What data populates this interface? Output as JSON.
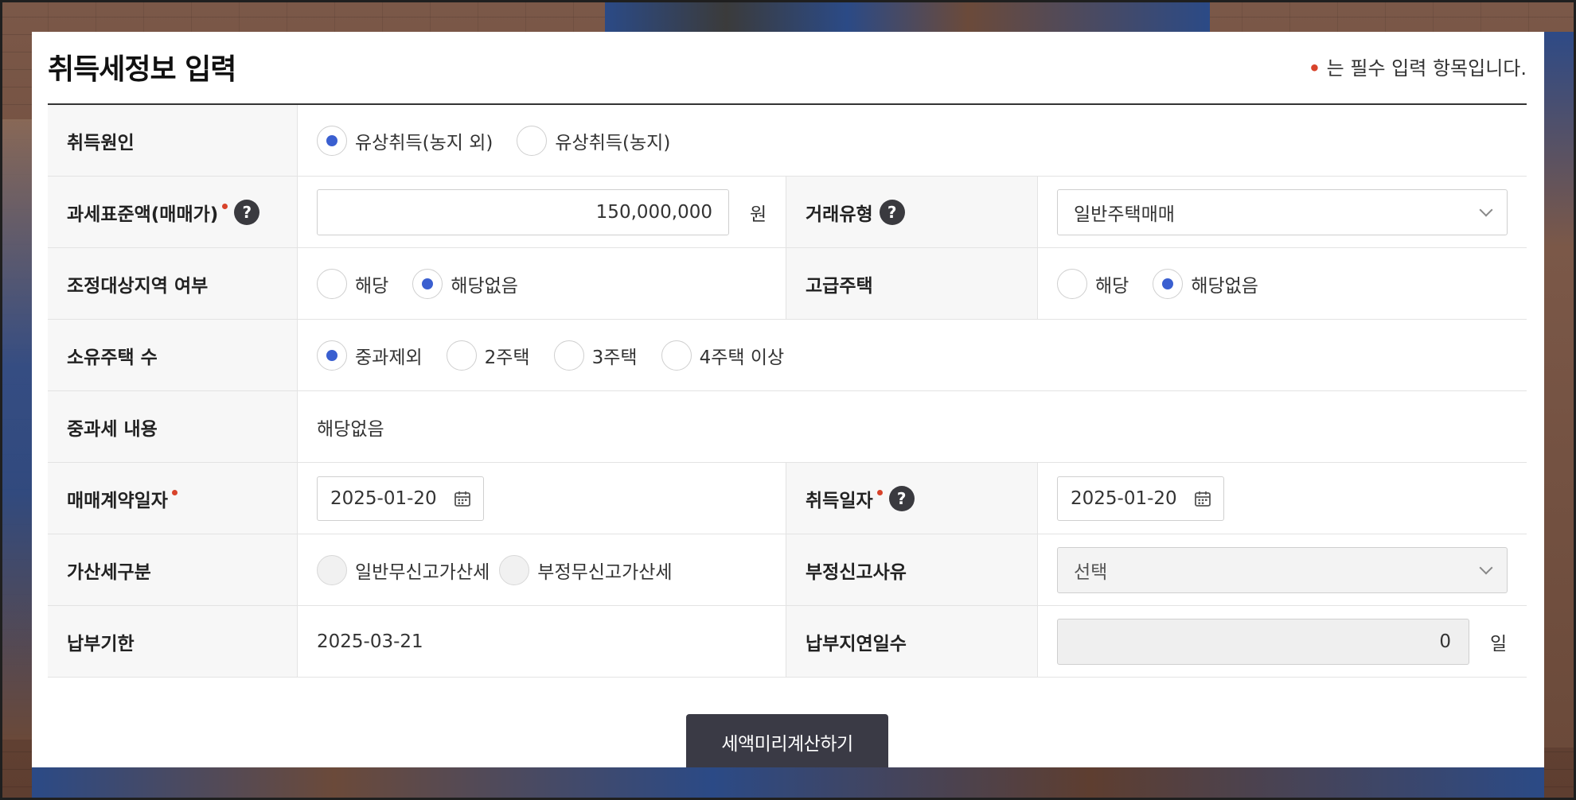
{
  "title": "취득세정보 입력",
  "required_note": "는 필수 입력 항목입니다.",
  "rows": {
    "acq_cause": {
      "label": "취득원인",
      "options": [
        "유상취득(농지 외)",
        "유상취득(농지)"
      ],
      "selected": 0
    },
    "tax_base": {
      "label": "과세표준액(매매가)",
      "value": "150,000,000",
      "unit": "원"
    },
    "trade_type": {
      "label": "거래유형",
      "value": "일반주택매매"
    },
    "adjust_area": {
      "label": "조정대상지역 여부",
      "options": [
        "해당",
        "해당없음"
      ],
      "selected": 1
    },
    "luxury": {
      "label": "고급주택",
      "options": [
        "해당",
        "해당없음"
      ],
      "selected": 1
    },
    "house_count": {
      "label": "소유주택 수",
      "options": [
        "중과제외",
        "2주택",
        "3주택",
        "4주택 이상"
      ],
      "selected": 0
    },
    "heavy_tax": {
      "label": "중과세 내용",
      "value": "해당없음"
    },
    "contract_date": {
      "label": "매매계약일자",
      "value": "2025-01-20"
    },
    "acq_date": {
      "label": "취득일자",
      "value": "2025-01-20"
    },
    "penalty_type": {
      "label": "가산세구분",
      "options": [
        "일반무신고가산세",
        "부정무신고가산세"
      ]
    },
    "fraud_reason": {
      "label": "부정신고사유",
      "value": "선택"
    },
    "due_date": {
      "label": "납부기한",
      "value": "2025-03-21"
    },
    "delay_days": {
      "label": "납부지연일수",
      "value": "0",
      "unit": "일"
    }
  },
  "submit_label": "세액미리계산하기",
  "colors": {
    "accent": "#3a5fd0",
    "required": "#d8432b",
    "button": "#3a3a45"
  }
}
